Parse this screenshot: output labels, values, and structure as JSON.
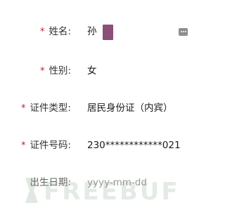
{
  "form": {
    "name": {
      "required_mark": "*",
      "label": "姓名:",
      "value": "孙"
    },
    "gender": {
      "required_mark": "*",
      "label": "性别:",
      "value": "女"
    },
    "id_type": {
      "required_mark": "*",
      "label": "证件类型:",
      "value": "居民身份证（内宾）"
    },
    "id_number": {
      "required_mark": "*",
      "label": "证件号码:",
      "value": "230************021"
    },
    "birth_date": {
      "label": "出生日期:",
      "placeholder": "yyyy-mm-dd"
    }
  },
  "watermark": {
    "text": "FREEBUF"
  },
  "colors": {
    "required": "#c2202c",
    "redaction": "#8c4f78",
    "placeholder": "#9a9a9a"
  },
  "icons": {
    "name_field_icon": "keyboard-icon"
  }
}
